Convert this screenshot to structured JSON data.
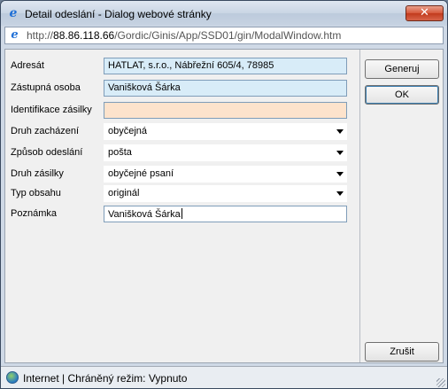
{
  "window": {
    "title": "Detail odeslání - Dialog webové stránky",
    "close_label": "✕"
  },
  "address": {
    "url_prefix": "http://",
    "url_host": "88.86.118.66",
    "url_path": "/Gordic/Ginis/App/SSD01/gin/ModalWindow.htm"
  },
  "form": {
    "adresat": {
      "label": "Adresát",
      "value": "HATLAT, s.r.o.,  Nábřežní 605/4,  78985"
    },
    "zastupna_osoba": {
      "label": "Zástupná osoba",
      "value": "Vanišková Šárka"
    },
    "identifikace": {
      "label": "Identifikace zásilky",
      "value": ""
    },
    "druh_zachazeni": {
      "label": "Druh zacházení",
      "value": "obyčejná"
    },
    "zpusob_odeslani": {
      "label": "Způsob odeslání",
      "value": "pošta"
    },
    "druh_zasilky": {
      "label": "Druh zásilky",
      "value": "obyčejné psaní"
    },
    "typ_obsahu": {
      "label": "Typ obsahu",
      "value": "originál"
    },
    "poznamka": {
      "label": "Poznámka",
      "value": "Vanišková Šárka"
    }
  },
  "buttons": {
    "generuj": "Generuj",
    "ok": "OK",
    "zrusit": "Zrušit"
  },
  "status": {
    "text": "Internet | Chráněný režim: Vypnuto"
  },
  "colors": {
    "readonly_bg": "#d8ecf8",
    "required_bg": "#fde3cc"
  }
}
